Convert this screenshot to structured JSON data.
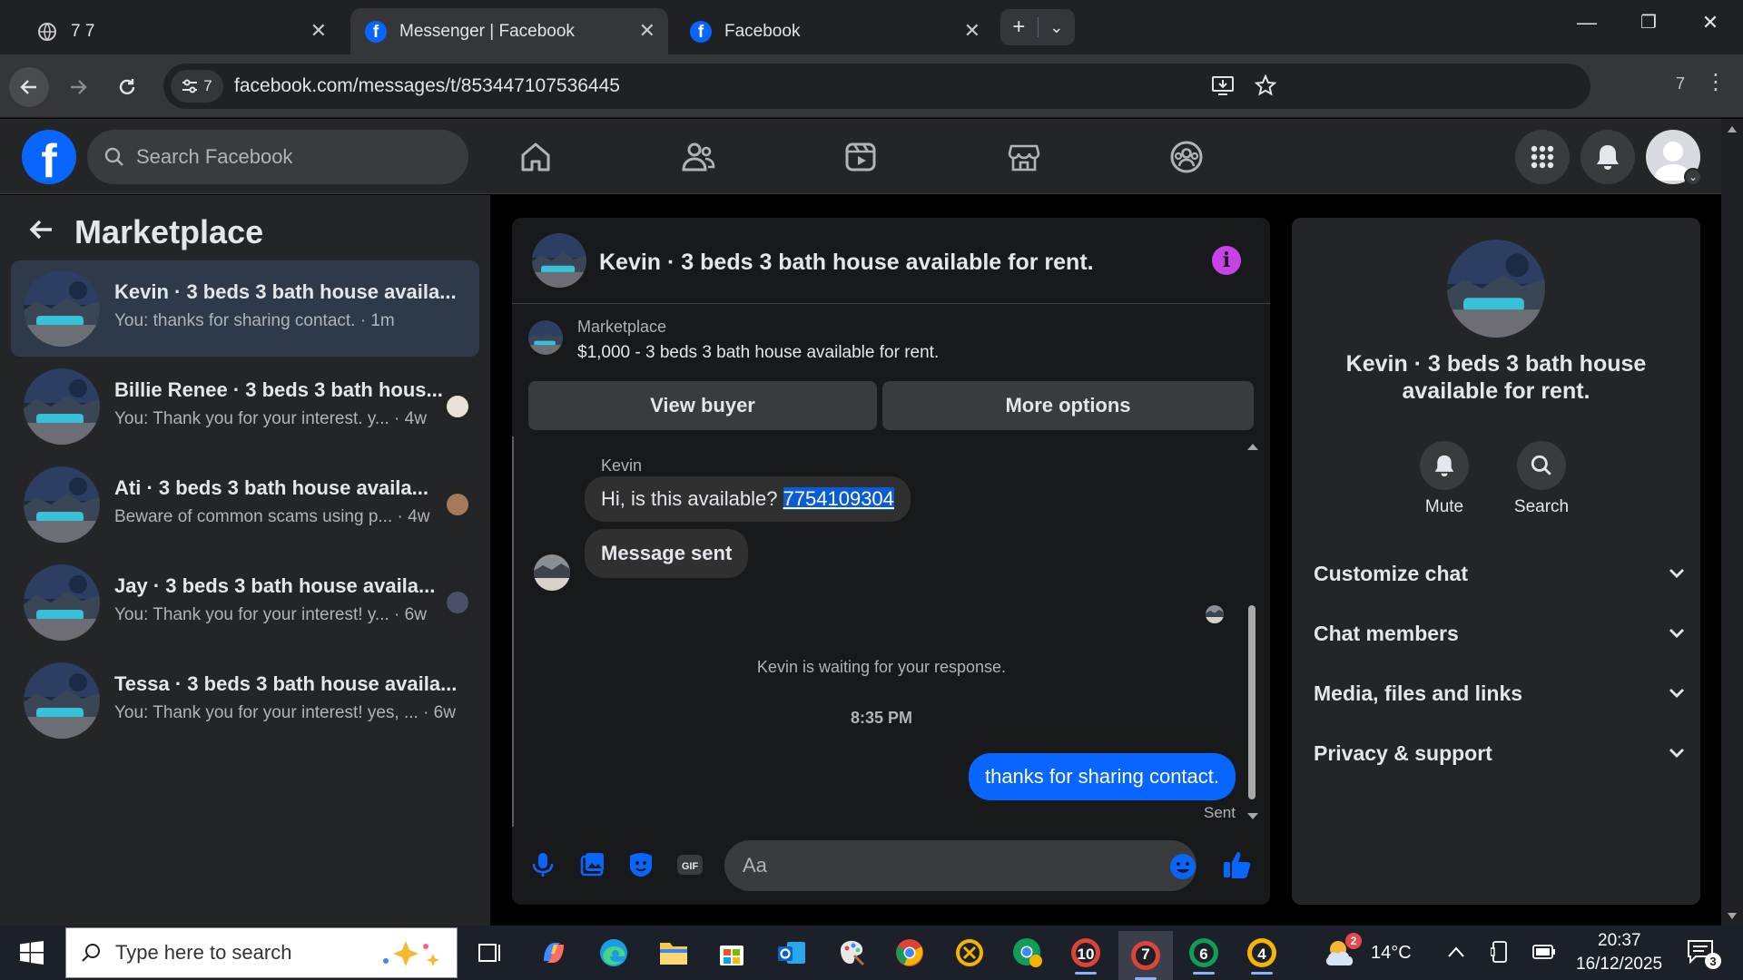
{
  "browser": {
    "tabs": [
      {
        "title": "7 7",
        "active": false
      },
      {
        "title": "Messenger | Facebook",
        "active": true
      },
      {
        "title": "Facebook",
        "active": false
      }
    ],
    "site_info_count": "7",
    "url": "facebook.com/messages/t/853447107536445",
    "extension_count": "7"
  },
  "fb": {
    "logo_letter": "f",
    "search_placeholder": "Search Facebook"
  },
  "left": {
    "title": "Marketplace",
    "conversations": [
      {
        "name": "Kevin · 3 beds 3 bath house availa...",
        "preview": "You: thanks for sharing contact. · 1m",
        "selected": true
      },
      {
        "name": "Billie Renee · 3 beds 3 bath hous...",
        "preview": "You: Thank you for your interest. y... · 4w"
      },
      {
        "name": "Ati · 3 beds 3 bath house availa...",
        "preview": "Beware of common scams using p... · 4w"
      },
      {
        "name": "Jay · 3 beds 3 bath house availa...",
        "preview": "You: Thank you for your interest! y... · 6w"
      },
      {
        "name": "Tessa · 3 beds 3 bath house availa...",
        "preview": "You: Thank you for your interest! yes, ... · 6w"
      }
    ]
  },
  "chat": {
    "title": "Kevin · 3 beds 3 bath house available for rent.",
    "listing_category": "Marketplace",
    "listing_title": "$1,000 - 3 beds 3 bath house available for rent.",
    "view_buyer": "View buyer",
    "more_options": "More options",
    "sender": "Kevin",
    "msg1_text": "Hi, is this available? ",
    "msg1_highlight": "7754109304",
    "msg2": "Message sent",
    "waiting": "Kevin is waiting for your response.",
    "time": "8:35 PM",
    "outgoing": "thanks for sharing contact.",
    "status": "Sent",
    "input_placeholder": "Aa"
  },
  "right": {
    "title": "Kevin · 3 beds 3 bath house available for rent.",
    "mute": "Mute",
    "search": "Search",
    "sections": [
      "Customize chat",
      "Chat members",
      "Media, files and links",
      "Privacy & support"
    ]
  },
  "taskbar": {
    "search_placeholder": "Type here to search",
    "badge_10": "10",
    "badge_7": "7",
    "badge_6": "6",
    "badge_4": "4",
    "weather_badge": "2",
    "temperature": "14°C",
    "time": "20:37",
    "date": "16/12/2025",
    "notifications": "3"
  },
  "colors": {
    "fb_blue": "#0866ff",
    "info_purple": "#c942e8",
    "panel": "#242526",
    "chat_bg": "#18191a"
  }
}
